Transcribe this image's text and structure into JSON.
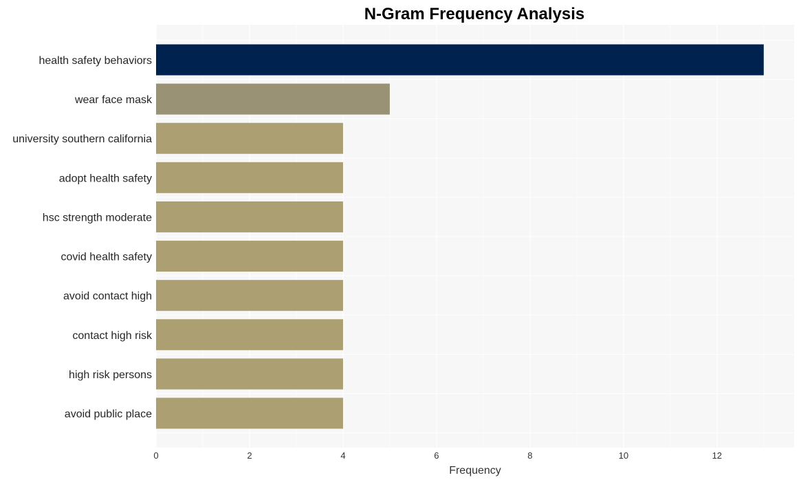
{
  "chart_data": {
    "type": "bar",
    "orientation": "horizontal",
    "title": "N-Gram Frequency Analysis",
    "xlabel": "Frequency",
    "ylabel": "",
    "xlim": [
      0,
      13.65
    ],
    "xticks": [
      0,
      2,
      4,
      6,
      8,
      10,
      12
    ],
    "grid": true,
    "categories": [
      "health safety behaviors",
      "wear face mask",
      "university southern california",
      "adopt health safety",
      "hsc strength moderate",
      "covid health safety",
      "avoid contact high",
      "contact high risk",
      "high risk persons",
      "avoid public place"
    ],
    "values": [
      13,
      5,
      4,
      4,
      4,
      4,
      4,
      4,
      4,
      4
    ],
    "colors": [
      "#00224e",
      "#999275",
      "#ac9f71",
      "#ac9f71",
      "#ac9f71",
      "#ac9f71",
      "#ac9f71",
      "#ac9f71",
      "#ac9f71",
      "#ac9f71"
    ],
    "background_color": "#f7f7f7",
    "grid_color": "#ffffff"
  }
}
